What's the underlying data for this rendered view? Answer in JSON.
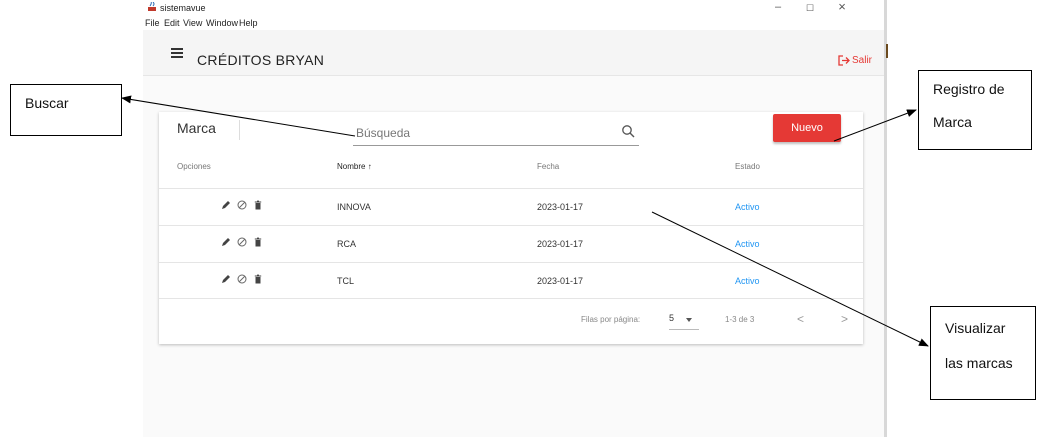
{
  "window": {
    "app_title": "sistemavue",
    "controls": {
      "minimize": "–",
      "maximize": "☐",
      "close": "×"
    }
  },
  "menu": {
    "items": [
      "File",
      "Edit",
      "View",
      "Window",
      "Help"
    ]
  },
  "toolbar": {
    "brand": "CRÉDITOS BRYAN",
    "logout_label": "Salir"
  },
  "card": {
    "title": "Marca",
    "search": {
      "placeholder": "Búsqueda"
    },
    "new_button": "Nuevo"
  },
  "table": {
    "headers": {
      "options": "Opciones",
      "name": "Nombre",
      "sort_arrow": "↑",
      "date": "Fecha",
      "status": "Estado"
    },
    "rows": [
      {
        "nombre": "INNOVA",
        "fecha": "2023-01-17",
        "estado": "Activo"
      },
      {
        "nombre": "RCA",
        "fecha": "2023-01-17",
        "estado": "Activo"
      },
      {
        "nombre": "TCL",
        "fecha": "2023-01-17",
        "estado": "Activo"
      }
    ],
    "footer": {
      "rows_per_page_label": "Filas por página:",
      "rows_per_page": "5",
      "range": "1-3 de 3",
      "prev": "<",
      "next": ">"
    }
  },
  "annotations": {
    "buscar": "Buscar",
    "registro_line1": "Registro de",
    "registro_line2": "Marca",
    "visualizar_line1": "Visualizar",
    "visualizar_line2": "las marcas"
  },
  "colors": {
    "accent": "#e53935",
    "status": "#2196f3"
  }
}
